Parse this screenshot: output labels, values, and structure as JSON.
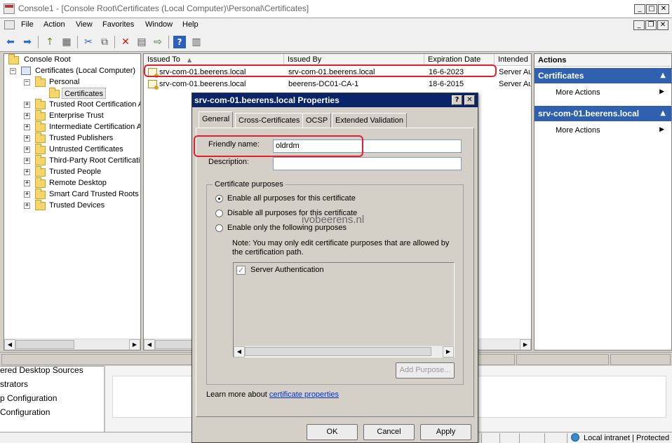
{
  "window": {
    "title": "Console1 - [Console Root\\Certificates (Local Computer)\\Personal\\Certificates]"
  },
  "menu": [
    "File",
    "Action",
    "View",
    "Favorites",
    "Window",
    "Help"
  ],
  "tree": {
    "root": "Console Root",
    "store": "Certificates (Local Computer)",
    "personal": "Personal",
    "certificates": "Certificates",
    "items": [
      "Trusted Root Certification A",
      "Enterprise Trust",
      "Intermediate Certification A",
      "Trusted Publishers",
      "Untrusted Certificates",
      "Third-Party Root Certificatio",
      "Trusted People",
      "Remote Desktop",
      "Smart Card Trusted Roots",
      "Trusted Devices"
    ]
  },
  "list": {
    "columns": [
      "Issued To",
      "Issued By",
      "Expiration Date",
      "Intended"
    ],
    "rows": [
      {
        "issued_to": "srv-com-01.beerens.local",
        "issued_by": "srv-com-01.beerens.local",
        "expiration": "16-6-2023",
        "intended": "Server Au"
      },
      {
        "issued_to": "srv-com-01.beerens.local",
        "issued_by": "beerens-DC01-CA-1",
        "expiration": "18-6-2015",
        "intended": "Server Au"
      }
    ]
  },
  "actions": {
    "header": "Actions",
    "sections": [
      {
        "title": "Certificates",
        "item": "More Actions"
      },
      {
        "title": "srv-com-01.beerens.local",
        "item": "More Actions"
      }
    ]
  },
  "behind": {
    "lines": [
      "ered Desktop Sources",
      "strators",
      "p Configuration",
      "Configuration"
    ]
  },
  "statusbar": {
    "zone": "Local intranet | Protected"
  },
  "dialog": {
    "title": "srv-com-01.beerens.local Properties",
    "tabs": [
      "General",
      "Cross-Certificates",
      "OCSP",
      "Extended Validation"
    ],
    "friendly_name_label": "Friendly name:",
    "friendly_name_value": "oldrdm",
    "description_label": "Description:",
    "description_value": "",
    "purposes_group": "Certificate purposes",
    "radio_options": [
      "Enable all purposes for this certificate",
      "Disable all purposes for this certificate",
      "Enable only the following purposes"
    ],
    "selected_option": 0,
    "note": "Note: You may only edit certificate purposes that are allowed by the certification path.",
    "purpose_items": [
      {
        "label": "Server Authentication",
        "checked": true
      }
    ],
    "add_purpose": "Add Purpose...",
    "learn_more_prefix": "Learn more about",
    "learn_more_link": "certificate properties",
    "ok": "OK",
    "cancel": "Cancel",
    "apply": "Apply"
  },
  "watermark": "ivobeerens.nl",
  "colors": {
    "highlight": "#e0202c",
    "link": "#0033cc",
    "actions_header": "#3060b0"
  }
}
